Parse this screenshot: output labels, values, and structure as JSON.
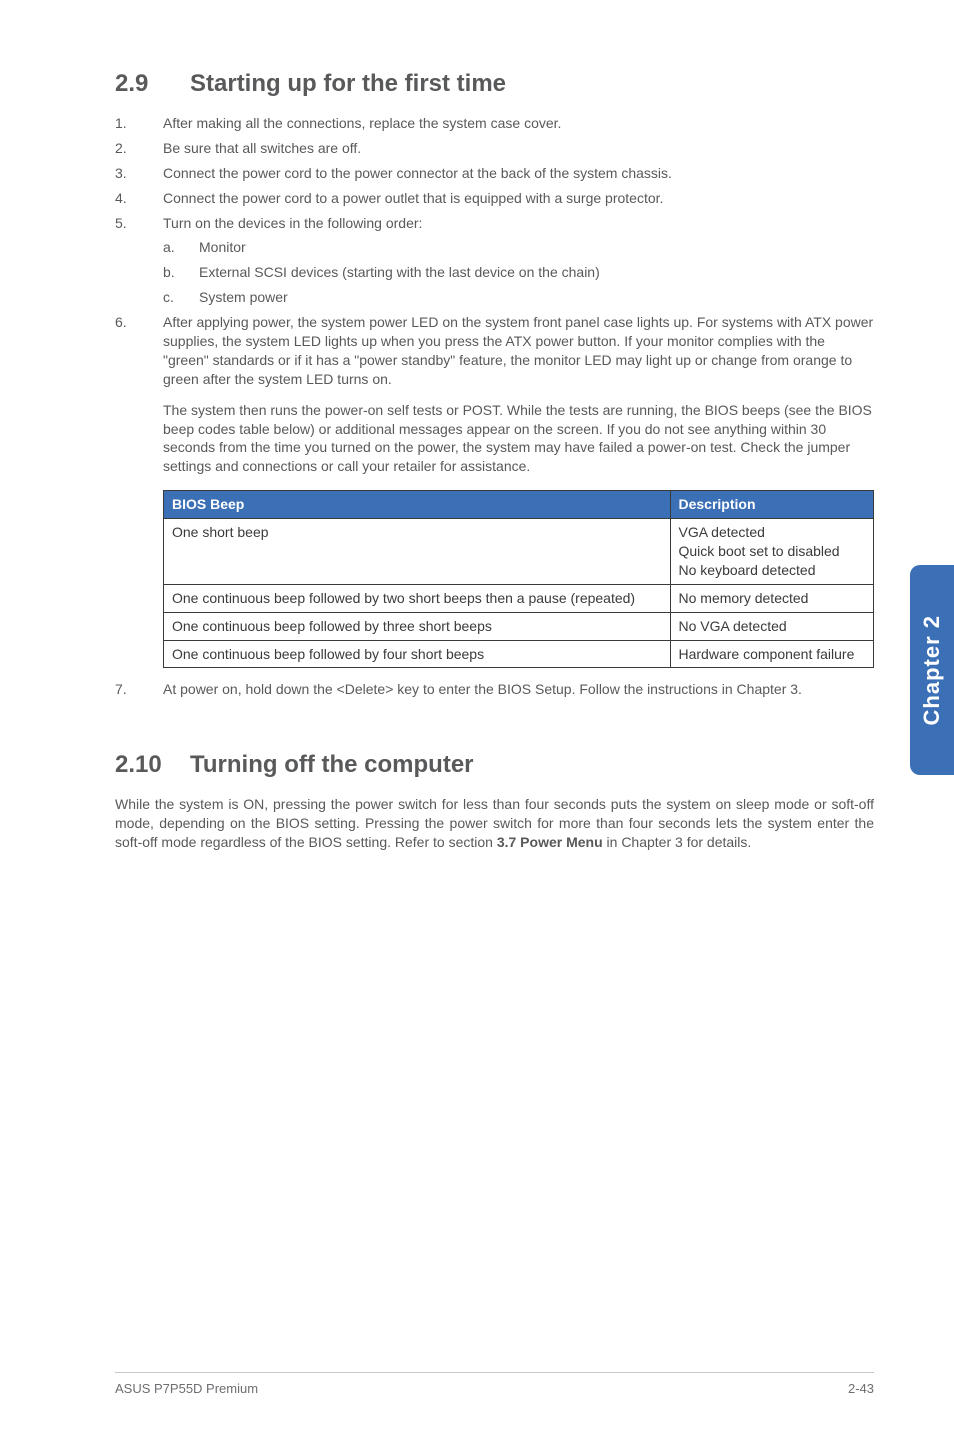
{
  "sidebar": {
    "label": "Chapter 2"
  },
  "section29": {
    "number": "2.9",
    "title": "Starting up for the first time",
    "items": [
      {
        "text": "After making all the connections, replace the system case cover."
      },
      {
        "text": "Be sure that all switches are off."
      },
      {
        "text": "Connect the power cord to the power connector at the back of the system chassis."
      },
      {
        "text": "Connect the power cord to a power outlet that is equipped with a surge protector."
      },
      {
        "text": "Turn on the devices in the following order:",
        "sub": [
          {
            "letter": "a.",
            "text": "Monitor"
          },
          {
            "letter": "b.",
            "text": "External SCSI devices (starting with the last device on the chain)"
          },
          {
            "letter": "c.",
            "text": "System power"
          }
        ]
      },
      {
        "text": "After applying power, the system power LED on the system front panel case lights up. For systems with ATX power supplies, the system LED lights up when you press the ATX power button. If your monitor complies with the \"green\" standards or if it has a \"power standby\" feature, the monitor LED may light up or change from orange to green after the system LED turns on.",
        "para2": "The system then runs the power-on self tests or POST. While the tests are running, the BIOS beeps (see the BIOS beep codes table below) or additional messages appear on the screen. If you do not see anything within 30 seconds from the time you turned on the power, the system may have failed a power-on test. Check the jumper settings and connections or call your retailer for assistance."
      },
      {
        "text": "At power on, hold down the <Delete> key to enter the BIOS Setup. Follow the instructions in Chapter 3."
      }
    ]
  },
  "table": {
    "headers": [
      "BIOS Beep",
      "Description"
    ],
    "rows": [
      {
        "beep": "One short beep",
        "desc": "VGA detected\nQuick boot set to disabled\nNo keyboard detected"
      },
      {
        "beep": "One continuous beep followed by two short beeps then a pause (repeated)",
        "desc": "No memory detected"
      },
      {
        "beep": "One continuous beep followed by three short beeps",
        "desc": "No VGA detected"
      },
      {
        "beep": "One continuous beep followed by four short beeps",
        "desc": "Hardware component failure"
      }
    ]
  },
  "section210": {
    "number": "2.10",
    "title": "Turning off the computer",
    "body_pre": "While the system is ON, pressing the power switch for less than four seconds puts the system on sleep mode or soft-off mode, depending on the BIOS setting. Pressing the power switch for more than four seconds lets the system enter the soft-off mode regardless of the BIOS setting. Refer to section ",
    "body_bold": "3.7 Power Menu",
    "body_post": " in Chapter 3 for details."
  },
  "footer": {
    "left": "ASUS P7P55D Premium",
    "right": "2-43"
  }
}
